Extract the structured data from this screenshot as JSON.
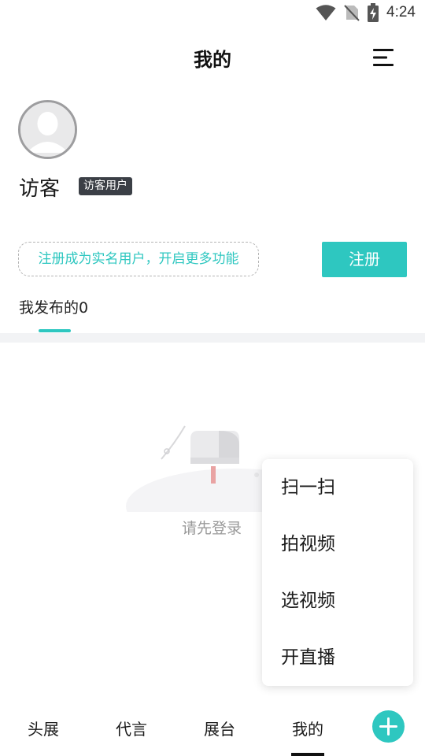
{
  "status_bar": {
    "time": "4:24",
    "icons": [
      "wifi-icon",
      "no-sim-icon",
      "battery-charging-icon"
    ]
  },
  "header": {
    "title": "我的",
    "menu_icon": "hamburger-menu-icon"
  },
  "profile": {
    "avatar_icon": "default-avatar-icon",
    "name": "访客",
    "badge": "访客用户"
  },
  "promo": {
    "text": "注册成为实名用户，开启更多功能",
    "register_label": "注册"
  },
  "tabs": {
    "published_label": "我发布的",
    "published_count": "0"
  },
  "empty_state": {
    "illustration": "mailbox-icon",
    "text": "请先登录"
  },
  "popup_menu": {
    "items": [
      "扫一扫",
      "拍视频",
      "选视频",
      "开直播"
    ]
  },
  "bottom_nav": {
    "items": [
      "头展",
      "代言",
      "展台",
      "我的"
    ],
    "active": "我的",
    "fab_icon": "plus-icon"
  },
  "colors": {
    "accent": "#2ec7c0",
    "badge_bg": "#3b3f46",
    "empty_text": "#999999"
  }
}
